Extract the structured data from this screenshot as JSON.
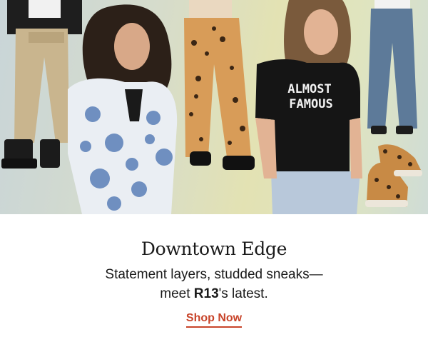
{
  "hero": {
    "shirt_text_line1": "ALMOST",
    "shirt_text_line2": "FAMOUS"
  },
  "promo": {
    "headline": "Downtown Edge",
    "body_line1": "Statement layers, studded sneaks—",
    "body_line2_prefix": "meet ",
    "body_brand": "R13",
    "body_line2_suffix": "'s latest.",
    "cta_label": "Shop Now"
  },
  "colors": {
    "cta": "#c8442a",
    "text": "#1a1a1a",
    "background": "#ffffff"
  }
}
